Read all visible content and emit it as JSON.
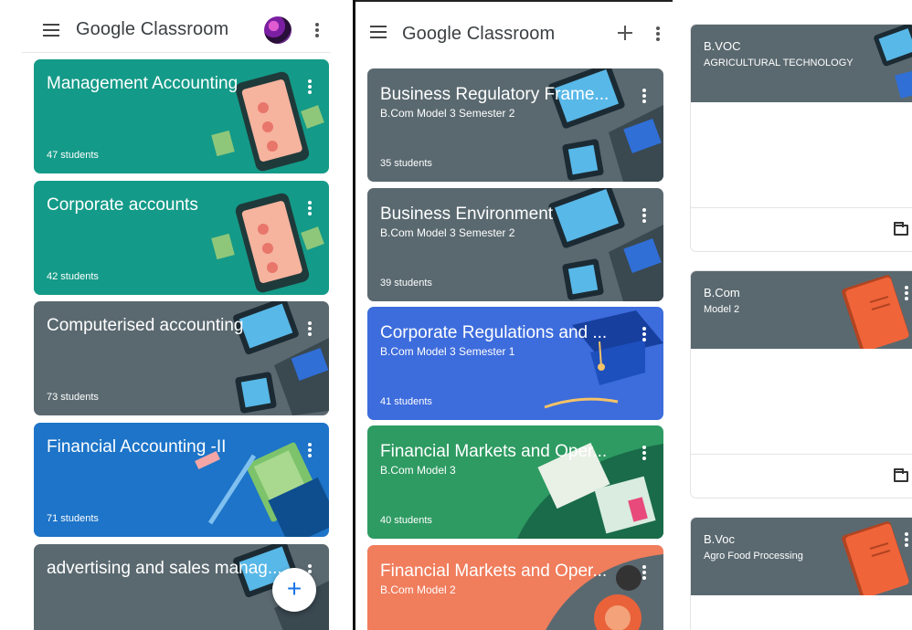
{
  "app_title": "Google Classroom",
  "panel1": {
    "classes": [
      {
        "title": "Management Accounting",
        "students": "47 students",
        "color": "#149a88"
      },
      {
        "title": "Corporate accounts",
        "students": "42 students",
        "color": "#149a88"
      },
      {
        "title": "Computerised accounting",
        "students": "73 students",
        "color": "#5a6970"
      },
      {
        "title": "Financial Accounting -II",
        "students": "71 students",
        "color": "#1d74c8"
      },
      {
        "title": "advertising and sales manag...",
        "students": "",
        "color": "#5a6970"
      }
    ],
    "fab_label": "+"
  },
  "panel2": {
    "classes": [
      {
        "title": "Business Regulatory Frame...",
        "section": "B.Com Model 3 Semester 2",
        "students": "35 students",
        "color": "#5a6970"
      },
      {
        "title": "Business Environment",
        "section": "B.Com Model 3 Semester 2",
        "students": "39 students",
        "color": "#5a6970"
      },
      {
        "title": "Corporate Regulations and ...",
        "section": "B.Com Model 3 Semester 1",
        "students": "41 students",
        "color": "#3d6cdc"
      },
      {
        "title": "Financial Markets and Oper...",
        "section": "B.Com Model 3",
        "students": "40 students",
        "color": "#2e9b62"
      },
      {
        "title": "Financial Markets and Oper...",
        "section": "B.Com Model 2",
        "students": "",
        "color": "#f07d5c"
      }
    ]
  },
  "panel3": {
    "classes": [
      {
        "title": "B.VOC",
        "section": "AGRICULTURAL TECHNOLOGY"
      },
      {
        "title": "B.Com",
        "section": "Model 2"
      },
      {
        "title": "B.Voc",
        "section": "Agro Food Processing"
      }
    ]
  }
}
